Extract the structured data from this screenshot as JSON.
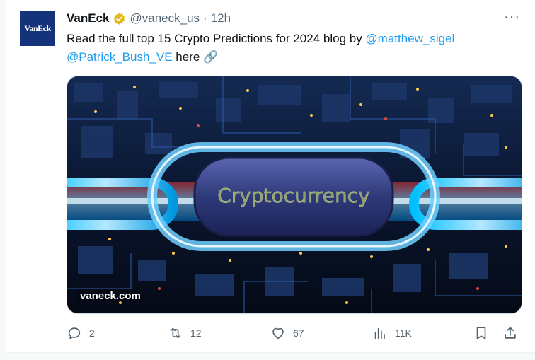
{
  "author": {
    "name": "VanEck",
    "handle": "@vaneck_us",
    "separator": "·",
    "time": "12h",
    "avatar_text": "VanEck"
  },
  "tweet": {
    "text_before": "Read the full top 15 Crypto Predictions for 2024 blog by ",
    "mention1": "@matthew_sigel",
    "mention2": "@Patrick_Bush_VE",
    "text_after": " here ",
    "link_emoji": "🔗"
  },
  "media": {
    "overlay_title": "Cryptocurrency",
    "domain": "vaneck.com"
  },
  "actions": {
    "replies": "2",
    "reposts": "12",
    "likes": "67",
    "views": "11K"
  },
  "menu": {
    "more_label": "···"
  },
  "colors": {
    "accent": "#1d9bf0",
    "muted": "#536471",
    "badge_gold": "#e2b719",
    "avatar_bg": "#14337a"
  },
  "icons": {
    "verified": "verified-badge-icon",
    "reply": "reply-icon",
    "repost": "repost-icon",
    "like": "heart-icon",
    "views": "analytics-icon",
    "bookmark": "bookmark-icon",
    "share": "share-icon",
    "more": "more-icon"
  }
}
